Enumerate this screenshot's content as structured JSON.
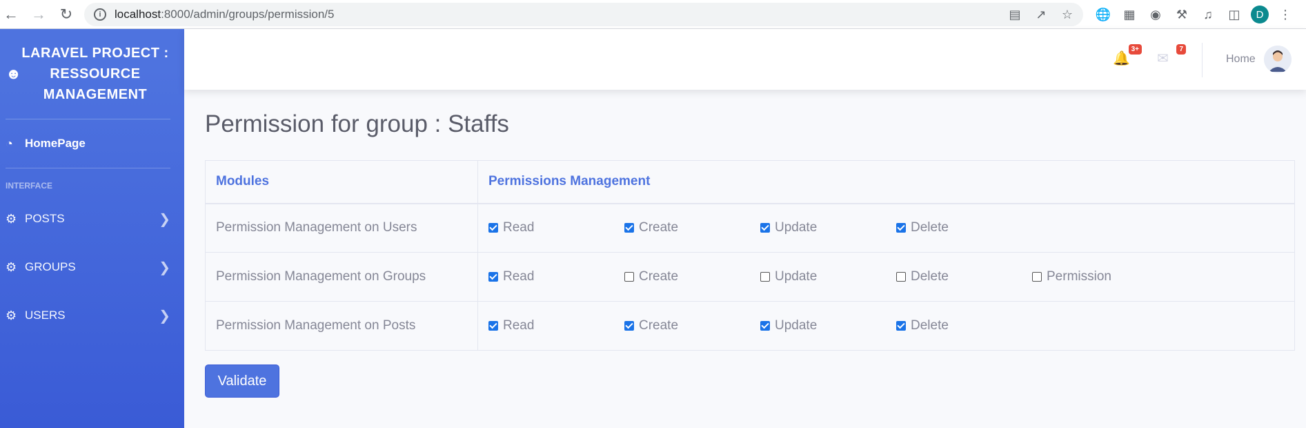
{
  "browser": {
    "url_host": "localhost",
    "url_path": ":8000/admin/groups/permission/5",
    "profile_initial": "D"
  },
  "sidebar": {
    "brand": "LARAVEL PROJECT : RESSOURCE MANAGEMENT",
    "home": "HomePage",
    "heading": "INTERFACE",
    "items": [
      {
        "label": "POSTS"
      },
      {
        "label": "GROUPS"
      },
      {
        "label": "USERS"
      }
    ]
  },
  "topbar": {
    "alerts_badge": "3+",
    "messages_badge": "7",
    "user_name": "Home"
  },
  "main": {
    "title": "Permission for group : Staffs",
    "headers": [
      "Modules",
      "Permissions Management"
    ],
    "rows": [
      {
        "module": "Permission Management on Users",
        "perms": [
          {
            "label": "Read",
            "checked": true
          },
          {
            "label": "Create",
            "checked": true
          },
          {
            "label": "Update",
            "checked": true
          },
          {
            "label": "Delete",
            "checked": true
          }
        ]
      },
      {
        "module": "Permission Management on Groups",
        "perms": [
          {
            "label": "Read",
            "checked": true
          },
          {
            "label": "Create",
            "checked": false
          },
          {
            "label": "Update",
            "checked": false
          },
          {
            "label": "Delete",
            "checked": false
          },
          {
            "label": "Permission",
            "checked": false
          }
        ]
      },
      {
        "module": "Permission Management on Posts",
        "perms": [
          {
            "label": "Read",
            "checked": true
          },
          {
            "label": "Create",
            "checked": true
          },
          {
            "label": "Update",
            "checked": true
          },
          {
            "label": "Delete",
            "checked": true
          }
        ]
      }
    ],
    "validate_label": "Validate"
  },
  "colors": {
    "primary": "#4e73df",
    "badge": "#e74a3b",
    "checkbox": "#1a73e8"
  }
}
